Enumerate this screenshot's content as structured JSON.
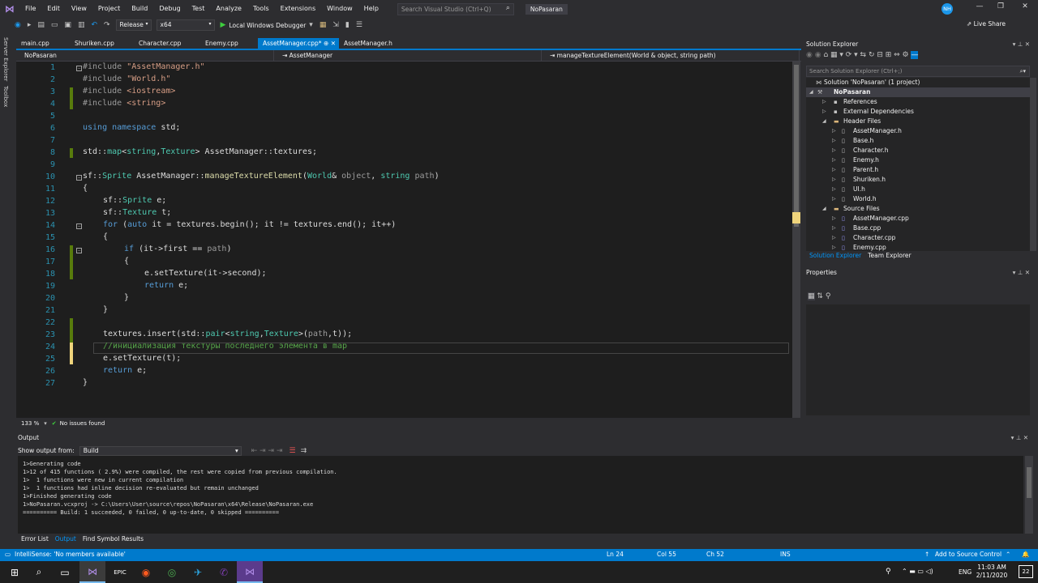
{
  "menu": [
    "File",
    "Edit",
    "View",
    "Project",
    "Build",
    "Debug",
    "Test",
    "Analyze",
    "Tools",
    "Extensions",
    "Window",
    "Help"
  ],
  "search_placeholder": "Search Visual Studio (Ctrl+Q)",
  "project_badge": "NoPasaran",
  "avatar_initials": "NH",
  "toolbar": {
    "config": "Release",
    "platform": "x64",
    "debugger": "Local Windows Debugger",
    "live_share": "Live Share"
  },
  "side_rail": [
    "Server Explorer",
    "Toolbox"
  ],
  "tabs": [
    "main.cpp",
    "Shuriken.cpp",
    "Character.cpp",
    "Enemy.cpp",
    "AssetManager.cpp*",
    "AssetManager.h"
  ],
  "navbar": {
    "project": "NoPasaran",
    "scope": "AssetManager",
    "member": "manageTextureElement(World & object, string path)"
  },
  "code": {
    "line_numbers": [
      "1",
      "2",
      "3",
      "4",
      "5",
      "6",
      "7",
      "8",
      "9",
      "10",
      "11",
      "12",
      "13",
      "14",
      "15",
      "16",
      "17",
      "18",
      "19",
      "20",
      "21",
      "22",
      "23",
      "24",
      "25",
      "26",
      "27"
    ],
    "l1a": "#include ",
    "l1b": "\"AssetManager.h\"",
    "l2a": "#include ",
    "l2b": "\"World.h\"",
    "l3a": "#include ",
    "l3b": "<iostream>",
    "l4a": "#include ",
    "l4b": "<string>",
    "l6a": "using namespace ",
    "l6b": "std;",
    "l8a": "std::",
    "l8b": "map",
    "l8c": "<",
    "l8d": "string",
    "l8e": ",",
    "l8f": "Texture",
    "l8g": "> AssetManager::textures;",
    "l10a": "sf::",
    "l10b": "Sprite",
    "l10c": " AssetManager::",
    "l10d": "manageTextureElement",
    "l10e": "(",
    "l10f": "World",
    "l10g": "& ",
    "l10h": "object",
    "l10i": ", ",
    "l10j": "string",
    "l10k": " ",
    "l10l": "path",
    "l10m": ")",
    "l11": "{",
    "l12a": "sf::",
    "l12b": "Sprite",
    "l12c": " e;",
    "l13a": "sf::",
    "l13b": "Texture",
    "l13c": " t;",
    "l14a": "for",
    "l14b": " (",
    "l14c": "auto",
    "l14d": " it = textures.begin(); it != textures.end(); it++)",
    "l15": "{",
    "l16a": "if",
    "l16b": " (it->first == ",
    "l16c": "path",
    "l16d": ")",
    "l17": "{",
    "l18": "e.setTexture(it->second);",
    "l19a": "return",
    "l19b": " e;",
    "l20": "}",
    "l21": "}",
    "l23a": "textures.insert(std::",
    "l23b": "pair",
    "l23c": "<",
    "l23d": "string",
    "l23e": ",",
    "l23f": "Texture",
    "l23g": ">(",
    "l23h": "path",
    "l23i": ",t));",
    "l24": "//инициализация текстуры последнего элемента в map",
    "l25": "e.setTexture(t);",
    "l26a": "return",
    "l26b": " e;",
    "l27": "}"
  },
  "editor_status": {
    "zoom": "133 %",
    "issues": "No issues found"
  },
  "solution_explorer": {
    "title": "Solution Explorer",
    "search": "Search Solution Explorer (Ctrl+;)",
    "tree": [
      "Solution 'NoPasaran' (1 project)",
      "NoPasaran",
      "References",
      "External Dependencies",
      "Header Files",
      "AssetManager.h",
      "Base.h",
      "Character.h",
      "Enemy.h",
      "Parent.h",
      "Shuriken.h",
      "UI.h",
      "World.h",
      "Source Files",
      "AssetManager.cpp",
      "Base.cpp",
      "Character.cpp",
      "Enemy.cpp"
    ],
    "tabs": [
      "Solution Explorer",
      "Team Explorer"
    ]
  },
  "properties": {
    "title": "Properties"
  },
  "output": {
    "title": "Output",
    "show_from_label": "Show output from:",
    "show_from_value": "Build",
    "lines": [
      "1>Generating code",
      "1>12 of 415 functions ( 2.9%) were compiled, the rest were copied from previous compilation.",
      "1>  1 functions were new in current compilation",
      "1>  1 functions had inline decision re-evaluated but remain unchanged",
      "1>Finished generating code",
      "1>NoPasaran.vcxproj -> C:\\Users\\User\\source\\repos\\NoPasaran\\x64\\Release\\NoPasaran.exe",
      "========== Build: 1 succeeded, 0 failed, 0 up-to-date, 0 skipped =========="
    ],
    "tabs": [
      "Error List",
      "Output",
      "Find Symbol Results"
    ]
  },
  "status": {
    "intellisense": "IntelliSense: 'No members available'",
    "ln": "Ln 24",
    "col": "Col 55",
    "ch": "Ch 52",
    "ins": "INS",
    "source_control": "Add to Source Control"
  },
  "taskbar": {
    "lang": "ENG",
    "time": "11:03 AM",
    "date": "2/11/2020",
    "notif": "22"
  },
  "colors": {
    "accent": "#007acc",
    "keyword": "#569cd6",
    "type": "#4ec9b0",
    "string": "#d69d85",
    "comment": "#57a64a"
  }
}
